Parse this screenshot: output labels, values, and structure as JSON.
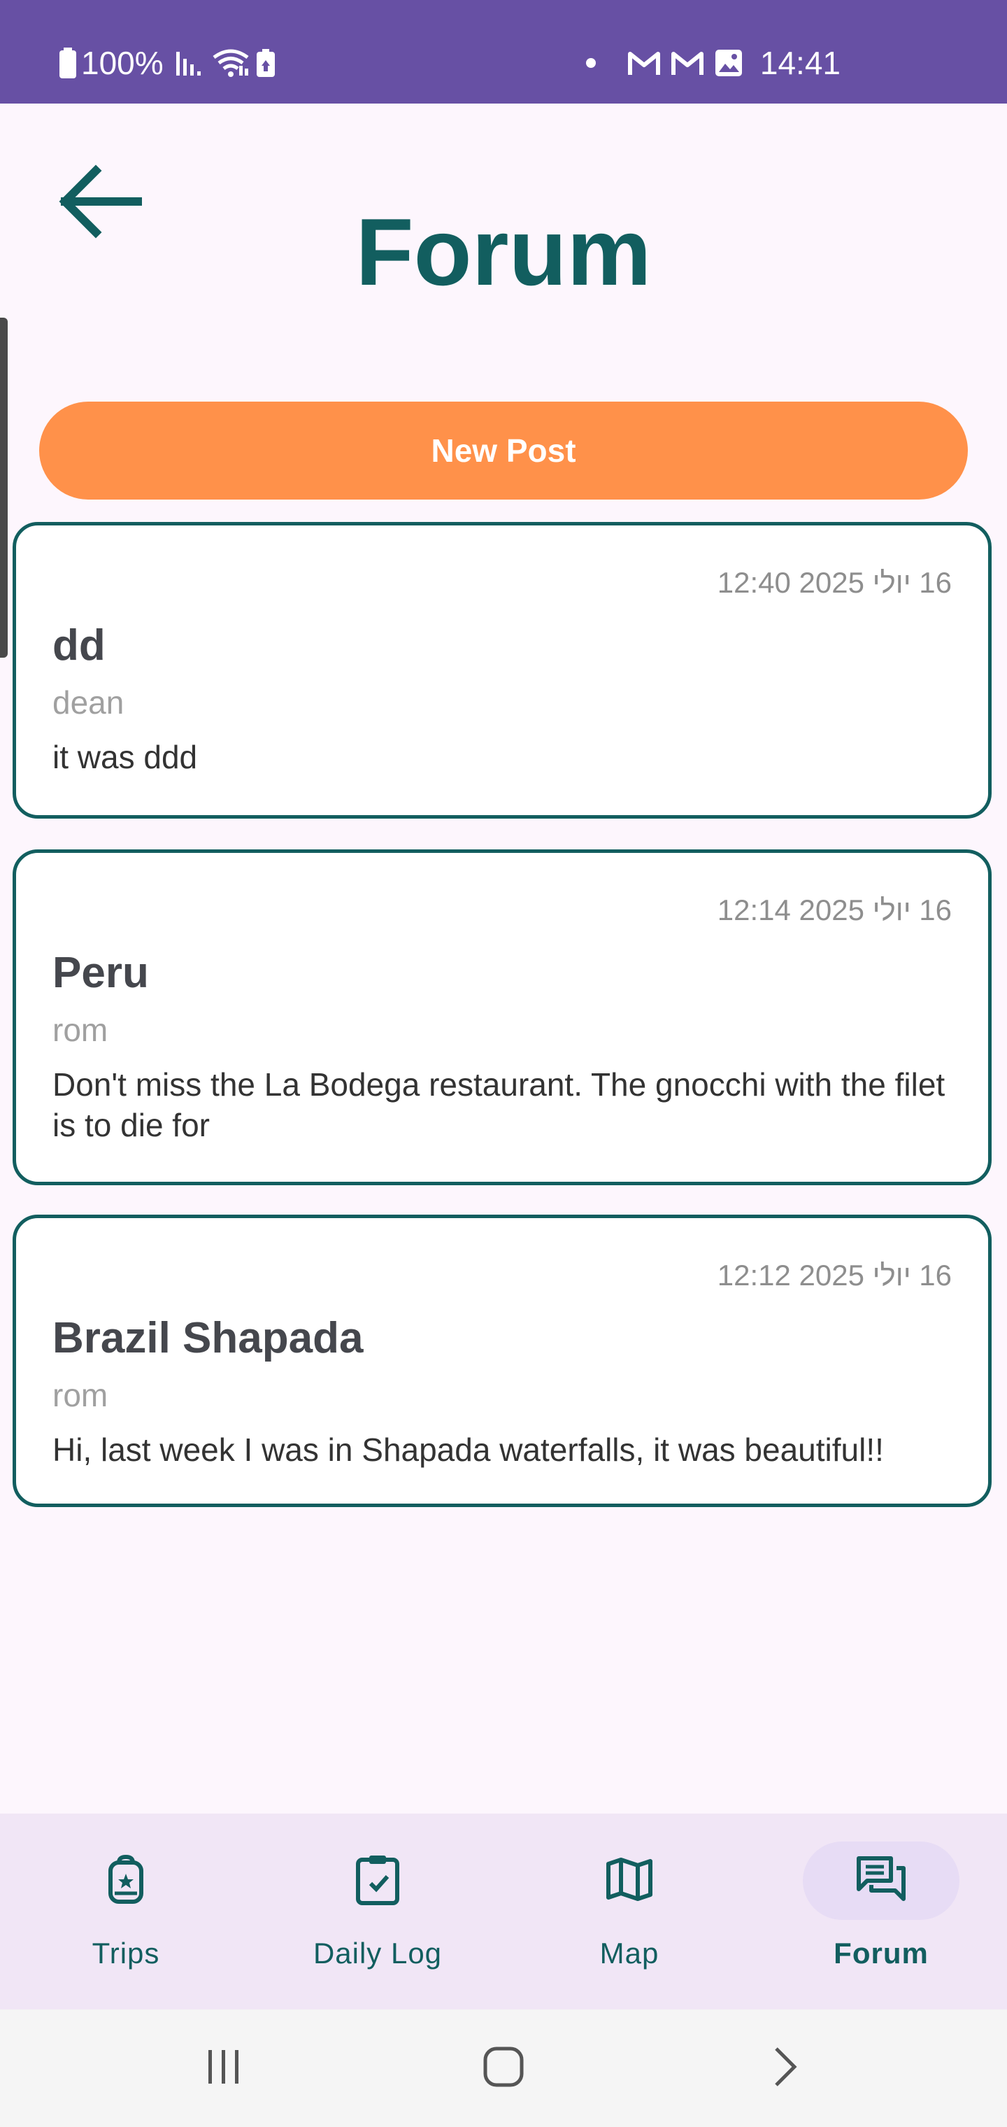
{
  "status_bar": {
    "battery": "100%",
    "time": "14:41"
  },
  "header": {
    "title": "Forum"
  },
  "new_post_label": "New Post",
  "posts": [
    {
      "date": "16 יולי 2025 12:40",
      "title": "dd",
      "author": "dean",
      "body": "it was ddd"
    },
    {
      "date": "16 יולי 2025 12:14",
      "title": "Peru",
      "author": "rom",
      "body": "Don't miss the La Bodega restaurant. The gnocchi with the filet is to die for"
    },
    {
      "date": "16 יולי 2025 12:12",
      "title": "Brazil Shapada",
      "author": "rom",
      "body": "Hi, last week I was in Shapada waterfalls, it was beautiful!!"
    }
  ],
  "bottom_nav": {
    "items": [
      {
        "label": "Trips",
        "icon": "backpack-icon",
        "active": false
      },
      {
        "label": "Daily Log",
        "icon": "clipboard-check-icon",
        "active": false
      },
      {
        "label": "Map",
        "icon": "map-icon",
        "active": false
      },
      {
        "label": "Forum",
        "icon": "forum-icon",
        "active": true
      }
    ]
  },
  "colors": {
    "status_bar": "#6750a4",
    "accent_teal": "#125e5f",
    "new_post_orange": "#ff914a",
    "background": "#fdf6fd",
    "nav_background": "#f1e6f6"
  }
}
